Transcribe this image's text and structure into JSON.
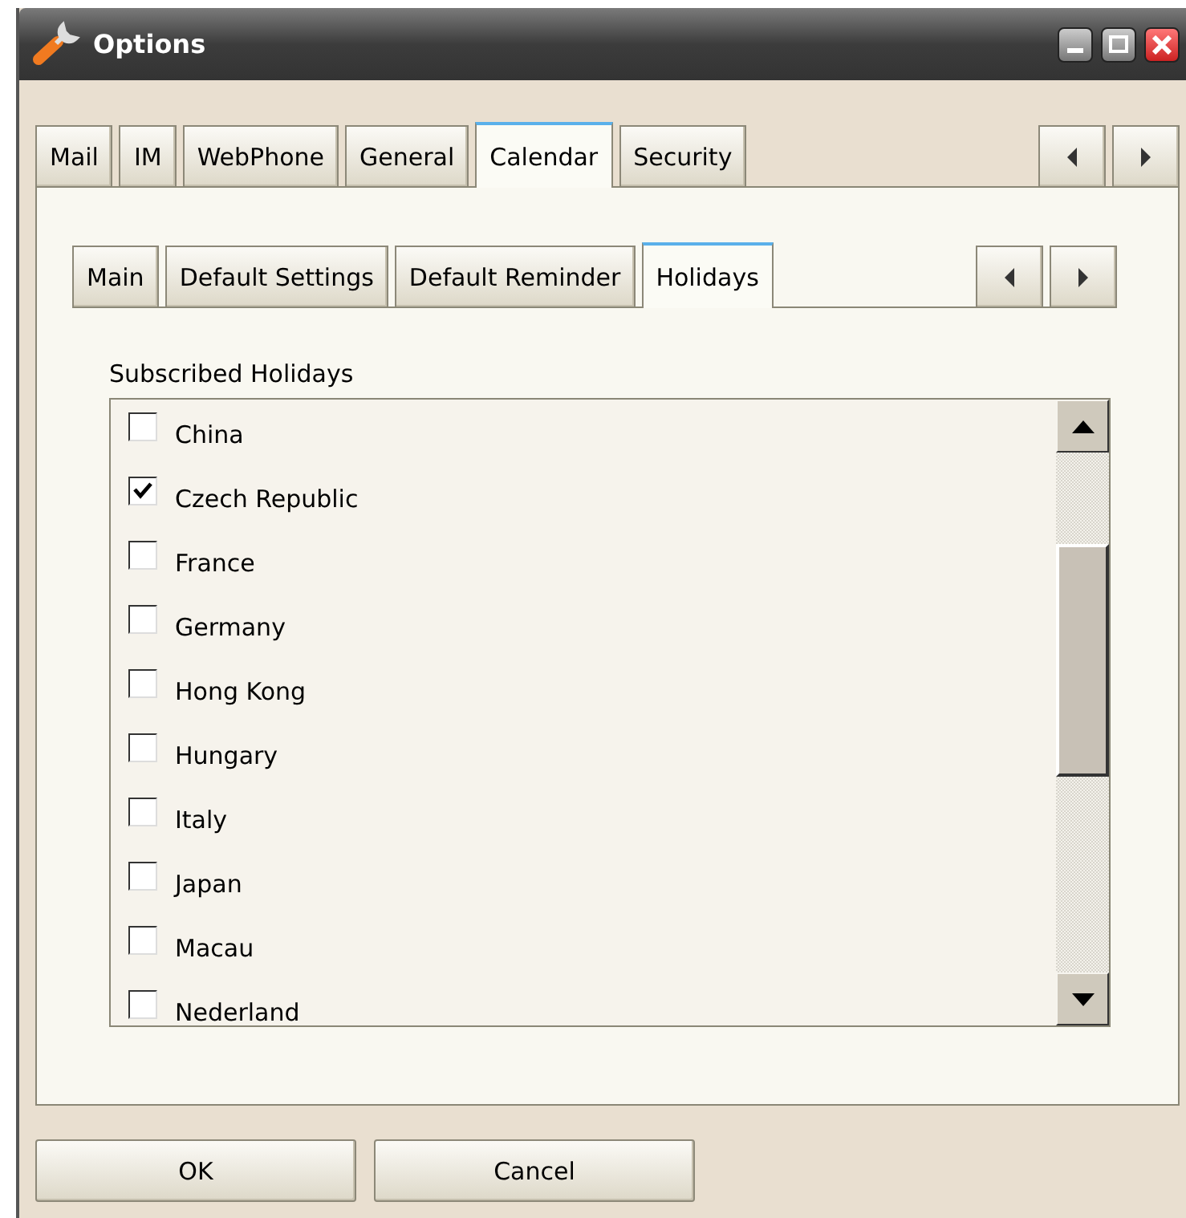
{
  "window": {
    "title": "Options"
  },
  "tabs": [
    {
      "label": "Mail",
      "selected": false
    },
    {
      "label": "IM",
      "selected": false
    },
    {
      "label": "WebPhone",
      "selected": false
    },
    {
      "label": "General",
      "selected": false
    },
    {
      "label": "Calendar",
      "selected": true
    },
    {
      "label": "Security",
      "selected": false
    }
  ],
  "subtabs": [
    {
      "label": "Main",
      "selected": false
    },
    {
      "label": "Default Settings",
      "selected": false
    },
    {
      "label": "Default Reminder",
      "selected": false
    },
    {
      "label": "Holidays",
      "selected": true
    }
  ],
  "holidays": {
    "label": "Subscribed Holidays",
    "items": [
      {
        "name": "China",
        "checked": false
      },
      {
        "name": "Czech Republic",
        "checked": true
      },
      {
        "name": "France",
        "checked": false
      },
      {
        "name": "Germany",
        "checked": false
      },
      {
        "name": "Hong Kong",
        "checked": false
      },
      {
        "name": "Hungary",
        "checked": false
      },
      {
        "name": "Italy",
        "checked": false
      },
      {
        "name": "Japan",
        "checked": false
      },
      {
        "name": "Macau",
        "checked": false
      },
      {
        "name": "Nederland",
        "checked": false
      }
    ]
  },
  "buttons": [
    "OK",
    "Cancel"
  ]
}
